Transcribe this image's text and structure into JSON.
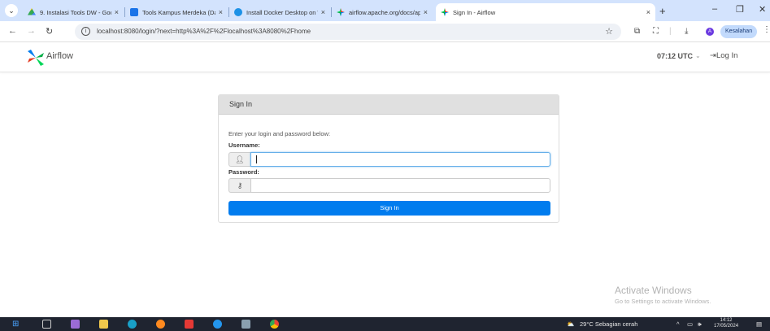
{
  "browser": {
    "tabs": [
      {
        "title": "9. Instalasi Tools DW - Goog",
        "icon": "google-drive-icon",
        "active": false
      },
      {
        "title": "Tools Kampus Merdeka (Dat",
        "icon": "sheets-icon",
        "active": false
      },
      {
        "title": "Install Docker Desktop on W",
        "icon": "docker-icon",
        "active": false
      },
      {
        "title": "airflow.apache.org/docs/apa",
        "icon": "airflow-icon",
        "active": false
      },
      {
        "title": "Sign In - Airflow",
        "icon": "airflow-icon",
        "active": true
      }
    ],
    "close_glyph": "×",
    "new_tab_glyph": "+",
    "url": "localhost:8080/login/?next=http%3A%2F%2Flocalhost%3A8080%2Fhome",
    "profile_initial": "A",
    "error_badge": "Kesalahan"
  },
  "airflow": {
    "brand": "Airflow",
    "time": "07:12 UTC",
    "login_link": "Log In",
    "colors": {
      "accent": "#017cee",
      "logo_red": "#e43921",
      "logo_teal": "#00ad46",
      "logo_blue": "#017cee",
      "logo_green": "#04d659"
    }
  },
  "signin": {
    "panel_title": "Sign In",
    "hint": "Enter your login and password below:",
    "username_label": "Username:",
    "username_value": "",
    "password_label": "Password:",
    "password_value": "",
    "button": "Sign In"
  },
  "watermark": {
    "title": "Activate Windows",
    "subtitle": "Go to Settings to activate Windows."
  },
  "taskbar": {
    "weather": "29°C  Sebagian cerah",
    "time": "14:12",
    "date": "17/05/2024"
  }
}
